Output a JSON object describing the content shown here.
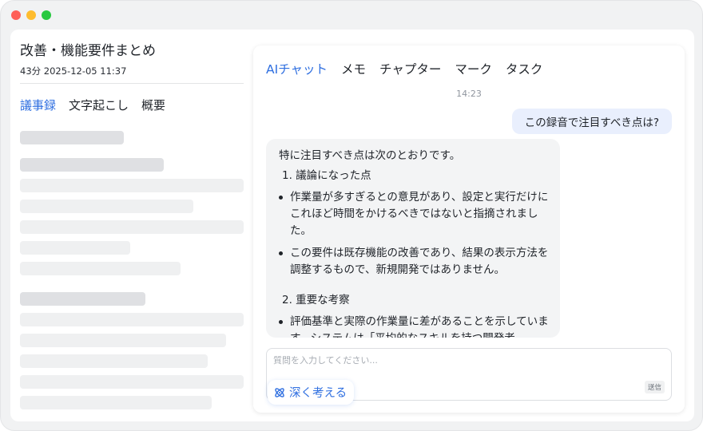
{
  "window": {
    "controls": [
      "close",
      "minimize",
      "maximize"
    ]
  },
  "left": {
    "title": "改善・機能要件まとめ",
    "meta": "43分 2025-12-05 11:37",
    "tabs": [
      {
        "label": "議事録",
        "active": true
      },
      {
        "label": "文字起こし",
        "active": false
      },
      {
        "label": "概要",
        "active": false
      }
    ]
  },
  "right": {
    "tabs": [
      {
        "label": "AIチャット",
        "active": true
      },
      {
        "label": "メモ",
        "active": false
      },
      {
        "label": "チャプター",
        "active": false
      },
      {
        "label": "マーク",
        "active": false
      },
      {
        "label": "タスク",
        "active": false
      }
    ],
    "chat_time": "14:23",
    "user_message": "この録音で注目すべき点は?",
    "ai_message": {
      "intro": "特に注目すべき点は次のとおりです。",
      "heading1": "1. 議論になった点",
      "bullet1": "作業量が多すぎるとの意見があり、設定と実行だけにこれほど時間をかけるべきではないと指摘されました。",
      "bullet2": "この要件は既存機能の改善であり、結果の表示方法を調整するもので、新規開発ではありません。",
      "heading2": "2. 重要な考察",
      "bullet3": "評価基準と実際の作業量に差があることを示しています。システムは「平均的なスキルを持つ開発者..."
    },
    "input": {
      "placeholder": "質問を入力してください...",
      "send_label": "送信"
    },
    "deep_think_label": "深く考える"
  },
  "colors": {
    "accent": "#2f6fe0",
    "user_bubble": "#e9effd",
    "ai_bubble": "#f3f4f5"
  },
  "icons": {
    "deep_think": "atom-icon"
  }
}
